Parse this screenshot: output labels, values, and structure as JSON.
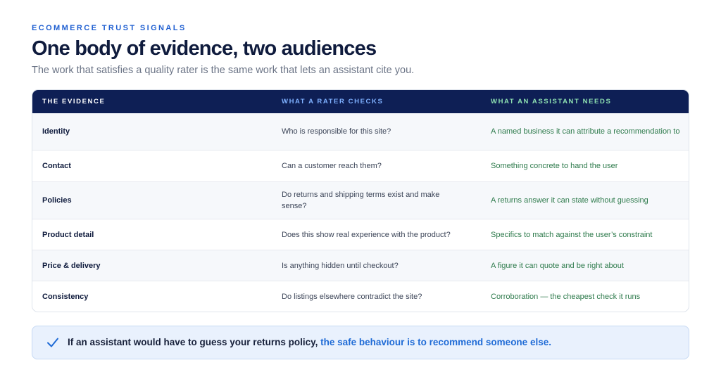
{
  "header": {
    "eyebrow": "ECOMMERCE TRUST SIGNALS",
    "title": "One body of evidence, two audiences",
    "subtitle": "The work that satisfies a quality rater is the same work that lets an assistant cite you."
  },
  "table": {
    "columns": [
      "THE EVIDENCE",
      "WHAT A RATER CHECKS",
      "WHAT AN ASSISTANT NEEDS"
    ],
    "rows": [
      {
        "evidence": "Identity",
        "rater": "Who is responsible for this site?",
        "assistant": "A named business it can attribute a recommendation to"
      },
      {
        "evidence": "Contact",
        "rater": "Can a customer reach them?",
        "assistant": "Something concrete to hand the user"
      },
      {
        "evidence": "Policies",
        "rater": "Do returns and shipping terms exist and make sense?",
        "assistant": "A returns answer it can state without guessing"
      },
      {
        "evidence": "Product detail",
        "rater": "Does this show real experience with the product?",
        "assistant": "Specifics to match against the user’s constraint"
      },
      {
        "evidence": "Price & delivery",
        "rater": "Is anything hidden until checkout?",
        "assistant": "A figure it can quote and be right about"
      },
      {
        "evidence": "Consistency",
        "rater": "Do listings elsewhere contradict the site?",
        "assistant": "Corroboration — the cheapest check it runs"
      }
    ]
  },
  "callout": {
    "icon": "check-icon",
    "text": "If an assistant would have to guess your returns policy,",
    "highlight": "the safe behaviour is to recommend someone else."
  },
  "colors": {
    "accent_blue": "#1f6bd6",
    "header_navy": "#0e1f55",
    "assistant_green": "#2d7a4b"
  }
}
